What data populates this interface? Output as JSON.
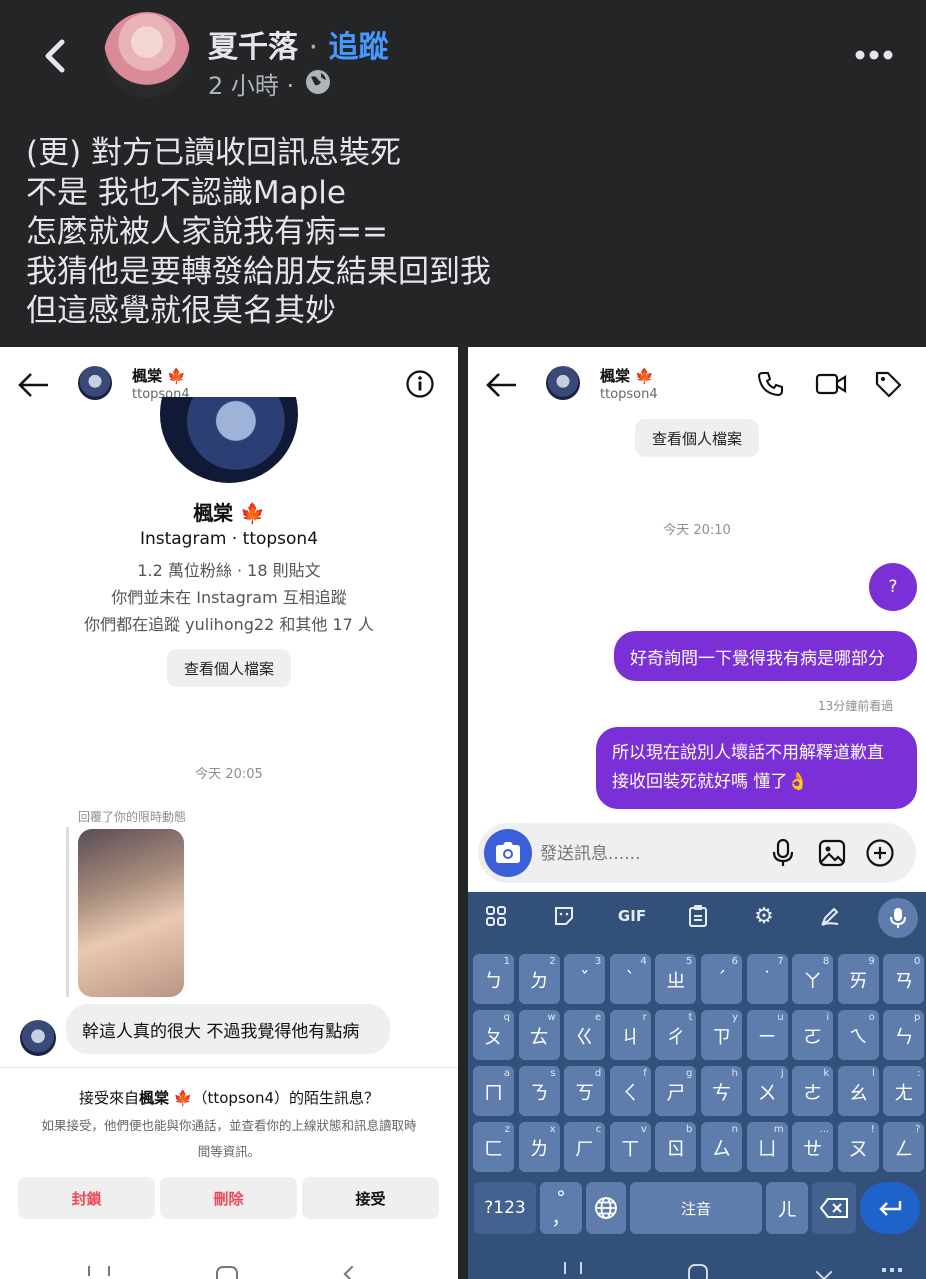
{
  "post": {
    "author": "夏千落",
    "separator": "·",
    "follow": "追蹤",
    "time": "2 小時 ·",
    "lines": [
      "(更) 對方已讀收回訊息裝死",
      "不是 我也不認識Maple",
      "怎麼就被人家說我有病==",
      "我猜他是要轉發給朋友結果回到我",
      "但這感覺就很莫名其妙"
    ]
  },
  "left": {
    "header": {
      "name": "楓棠",
      "leaf": "🍁",
      "username": "ttopson4"
    },
    "profile": {
      "name": "楓棠",
      "leaf": "🍁",
      "instagram": "Instagram · ttopson4",
      "stats": "1.2 萬位粉絲 · 18 則貼文",
      "mutual1": "你們並未在 Instagram 互相追蹤",
      "mutual2": "你們都在追蹤 yulihong22 和其他 17 人",
      "view_profile": "查看個人檔案"
    },
    "timestamp": "今天 20:05",
    "story_reply_label": "回覆了你的限時動態",
    "message": "幹這人真的很大 不過我覺得他有點病",
    "request": {
      "title_prefix": "接受來自",
      "title_name": "楓棠",
      "title_leaf": "🍁",
      "title_suffix": "（ttopson4）的陌生訊息？",
      "desc1": "如果接受，他們便也能與你通話，並查看你的上線狀態和訊息讀取時",
      "desc2": "間等資訊。",
      "block": "封鎖",
      "delete": "刪除",
      "accept": "接受"
    }
  },
  "right": {
    "header": {
      "name": "楓棠",
      "leaf": "🍁",
      "username": "ttopson4"
    },
    "view_profile": "查看個人檔案",
    "timestamp": "今天 20:10",
    "messages": [
      "?",
      "好奇詢問一下覺得我有病是哪部分",
      "所以現在說別人壞話不用解釋道歉直",
      "接收回裝死就好嗎 懂了👌"
    ],
    "seen": "13分鐘前看過",
    "input_placeholder": "發送訊息......",
    "keyboard": {
      "toolbar_gif": "GIF",
      "row1": [
        [
          "ㄅ",
          "1"
        ],
        [
          "ㄉ",
          "2"
        ],
        [
          "ˇ",
          "3"
        ],
        [
          "ˋ",
          "4"
        ],
        [
          "ㄓ",
          "5"
        ],
        [
          "ˊ",
          "6"
        ],
        [
          "˙",
          "7"
        ],
        [
          "ㄚ",
          "8"
        ],
        [
          "ㄞ",
          "9"
        ],
        [
          "ㄢ",
          "0"
        ]
      ],
      "row2": [
        [
          "ㄆ",
          "q"
        ],
        [
          "ㄊ",
          "w"
        ],
        [
          "ㄍ",
          "e"
        ],
        [
          "ㄐ",
          "r"
        ],
        [
          "ㄔ",
          "t"
        ],
        [
          "ㄗ",
          "y"
        ],
        [
          "ㄧ",
          "u"
        ],
        [
          "ㄛ",
          "i"
        ],
        [
          "ㄟ",
          "o"
        ],
        [
          "ㄣ",
          "p"
        ]
      ],
      "row3": [
        [
          "ㄇ",
          "a"
        ],
        [
          "ㄋ",
          "s"
        ],
        [
          "ㄎ",
          "d"
        ],
        [
          "ㄑ",
          "f"
        ],
        [
          "ㄕ",
          "g"
        ],
        [
          "ㄘ",
          "h"
        ],
        [
          "ㄨ",
          "j"
        ],
        [
          "ㄜ",
          "k"
        ],
        [
          "ㄠ",
          "l"
        ],
        [
          "ㄤ",
          ":"
        ]
      ],
      "row4": [
        [
          "ㄈ",
          "z"
        ],
        [
          "ㄌ",
          "x"
        ],
        [
          "ㄏ",
          "c"
        ],
        [
          "ㄒ",
          "v"
        ],
        [
          "ㄖ",
          "b"
        ],
        [
          "ㄙ",
          "n"
        ],
        [
          "ㄩ",
          "m"
        ],
        [
          "ㄝ",
          "..."
        ],
        [
          "ㄡ",
          "!"
        ],
        [
          "ㄥ",
          "?"
        ]
      ],
      "sym": "?123",
      "punct_top": "°",
      "punct_bottom": "，",
      "space": "注音",
      "er": "ㄦ"
    }
  }
}
